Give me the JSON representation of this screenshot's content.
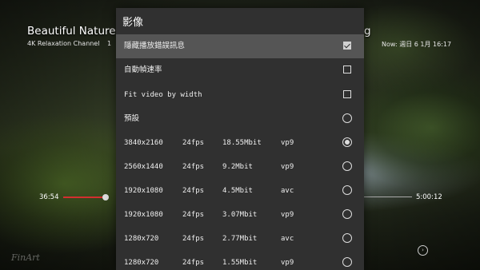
{
  "player": {
    "title_start": "Beautiful Nature Vid",
    "title_end": "g",
    "channel": "4K Relaxation Channel",
    "channel_tail": "1",
    "now_time": "Now: 週日 6 1月 16:17",
    "elapsed": "36:54",
    "duration": "5:00:12",
    "watermark": "FinArt",
    "seek_progress": 0.12
  },
  "dialog": {
    "title": "影像",
    "options": [
      {
        "kind": "checkbox",
        "label": "隱藏播放錯誤訊息",
        "checked": true,
        "selected": true
      },
      {
        "kind": "checkbox",
        "label": "自動幀速率",
        "checked": false
      },
      {
        "kind": "checkbox",
        "label": "Fit video by width",
        "checked": false
      },
      {
        "kind": "radio",
        "label": "預設",
        "checked": false
      }
    ],
    "formats": [
      {
        "res": "3840x2160",
        "fps": "24fps",
        "bitrate": "18.55Mbit",
        "codec": "vp9",
        "checked": true
      },
      {
        "res": "2560x1440",
        "fps": "24fps",
        "bitrate": "9.2Mbit",
        "codec": "vp9",
        "checked": false
      },
      {
        "res": "1920x1080",
        "fps": "24fps",
        "bitrate": "4.5Mbit",
        "codec": "avc",
        "checked": false
      },
      {
        "res": "1920x1080",
        "fps": "24fps",
        "bitrate": "3.07Mbit",
        "codec": "vp9",
        "checked": false
      },
      {
        "res": "1280x720",
        "fps": "24fps",
        "bitrate": "2.77Mbit",
        "codec": "avc",
        "checked": false
      },
      {
        "res": "1280x720",
        "fps": "24fps",
        "bitrate": "1.55Mbit",
        "codec": "vp9",
        "checked": false
      }
    ]
  }
}
